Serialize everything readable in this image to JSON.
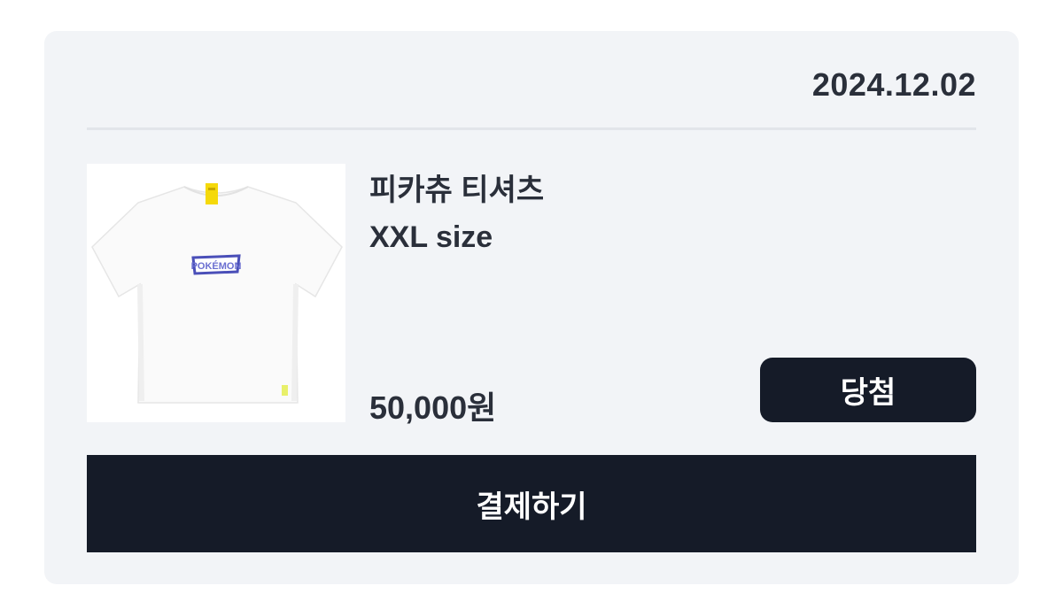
{
  "order": {
    "date": "2024.12.02",
    "product_name": "피카츄 티셔츠",
    "size": "XXL size",
    "price": "50,000원",
    "status": "당첨",
    "image_logo_text": "POKÉMON"
  },
  "actions": {
    "pay_label": "결제하기"
  },
  "colors": {
    "card_background": "#f2f4f7",
    "button_dark": "#151b28",
    "text_primary": "#2a2f3a",
    "divider": "#e2e5ea"
  }
}
